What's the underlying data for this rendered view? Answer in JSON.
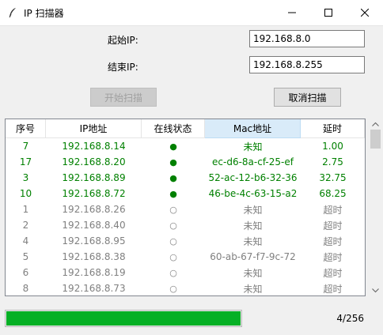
{
  "window": {
    "title": "IP 扫描器",
    "icon": "feather-icon"
  },
  "form": {
    "start_label": "起始IP:",
    "start_value": "192.168.8.0",
    "end_label": "结束IP:",
    "end_value": "192.168.8.255",
    "start_button": "开始扫描",
    "cancel_button": "取消扫描"
  },
  "table": {
    "columns": [
      "序号",
      "IP地址",
      "在线状态",
      "Mac地址",
      "延时"
    ],
    "rows": [
      {
        "index": "7",
        "ip": "192.168.8.14",
        "status": "●",
        "mac": "未知",
        "delay": "1.00",
        "online": true
      },
      {
        "index": "17",
        "ip": "192.168.8.20",
        "status": "●",
        "mac": "ec-d6-8a-cf-25-ef",
        "delay": "2.75",
        "online": true
      },
      {
        "index": "3",
        "ip": "192.168.8.89",
        "status": "●",
        "mac": "52-ac-12-b6-32-36",
        "delay": "32.75",
        "online": true
      },
      {
        "index": "10",
        "ip": "192.168.8.72",
        "status": "●",
        "mac": "46-be-4c-63-15-a2",
        "delay": "68.25",
        "online": true
      },
      {
        "index": "1",
        "ip": "192.168.8.26",
        "status": "○",
        "mac": "未知",
        "delay": "超时",
        "online": false
      },
      {
        "index": "2",
        "ip": "192.168.8.40",
        "status": "○",
        "mac": "未知",
        "delay": "超时",
        "online": false
      },
      {
        "index": "4",
        "ip": "192.168.8.95",
        "status": "○",
        "mac": "未知",
        "delay": "超时",
        "online": false
      },
      {
        "index": "5",
        "ip": "192.168.8.38",
        "status": "○",
        "mac": "60-ab-67-f7-9c-72",
        "delay": "超时",
        "online": false
      },
      {
        "index": "6",
        "ip": "192.168.8.19",
        "status": "○",
        "mac": "未知",
        "delay": "超时",
        "online": false
      },
      {
        "index": "8",
        "ip": "192.168.8.73",
        "status": "○",
        "mac": "未知",
        "delay": "超时",
        "online": false
      }
    ]
  },
  "progress": {
    "text": "4/256",
    "fraction": 1.0,
    "color": "#06b025"
  },
  "colors": {
    "online": "#008000",
    "offline": "#808080",
    "selected_header": "#d9ebf9"
  }
}
